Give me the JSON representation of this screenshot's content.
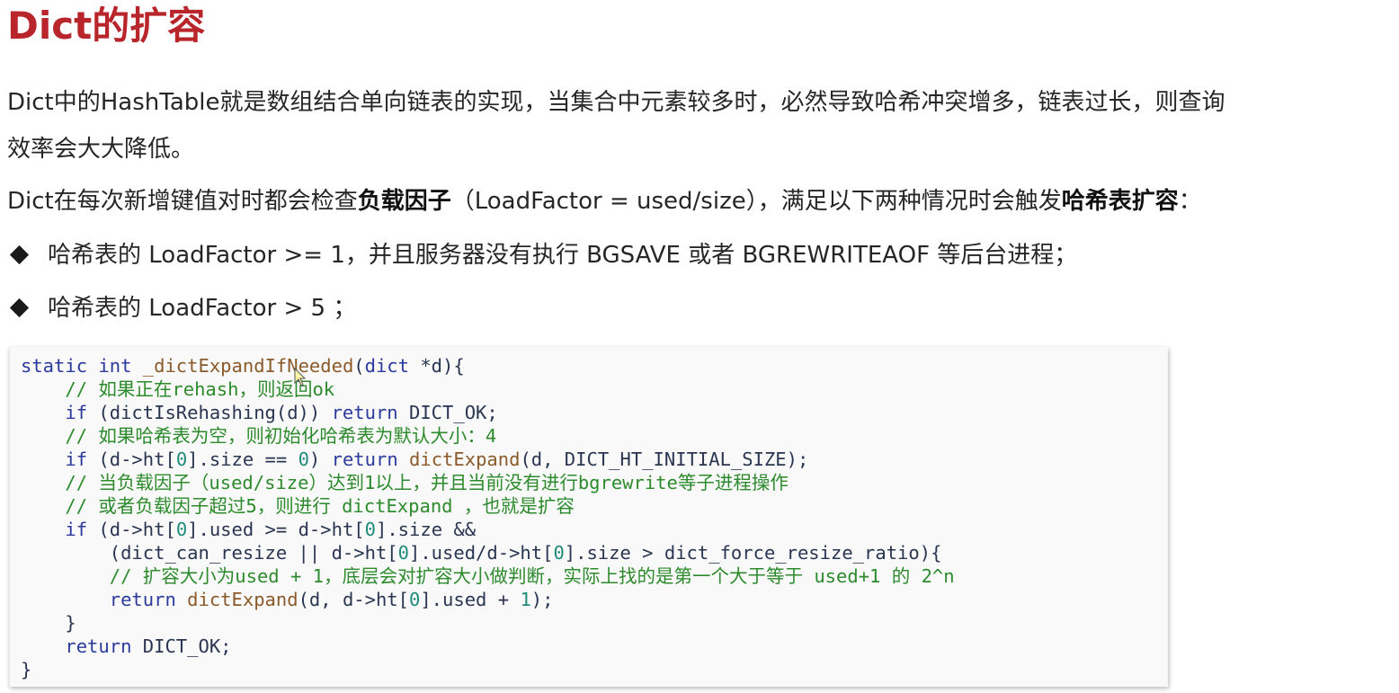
{
  "title": "Dict的扩容",
  "paragraphs": {
    "p1_line1": "Dict中的HashTable就是数组结合单向链表的实现，当集合中元素较多时，必然导致哈希冲突增多，链表过长，则查询",
    "p1_line2": "效率会大大降低。",
    "p2_pre": "Dict在每次新增键值对时都会检查",
    "p2_bold1": "负载因子",
    "p2_mid": "（LoadFactor = used/size），满足以下两种情况时会触发",
    "p2_bold2": "哈希表扩容",
    "p2_post": "："
  },
  "bullets": [
    "哈希表的 LoadFactor >= 1，并且服务器没有执行 BGSAVE 或者 BGREWRITEAOF 等后台进程；",
    "哈希表的 LoadFactor > 5 ；"
  ],
  "code": {
    "l1_kw1": "static",
    "l1_kw2": "int",
    "l1_fn": "_dictExpandIfNeeded",
    "l1_rest_a": "(",
    "l1_kw3": "dict",
    "l1_rest_b": " *d){",
    "l2": "    // 如果正在rehash，则返回ok",
    "l3_if": "if",
    "l3_a": " (dictIsRehashing(d)) ",
    "l3_ret": "return",
    "l3_b": " DICT_OK;",
    "l4": "    // 如果哈希表为空，则初始化哈希表为默认大小：4",
    "l5_if": "if",
    "l5_a": " (d->ht[",
    "l5_n0": "0",
    "l5_b": "].size == ",
    "l5_n1": "0",
    "l5_c": ") ",
    "l5_ret": "return",
    "l5_fn": " dictExpand",
    "l5_d": "(d, DICT_HT_INITIAL_SIZE);",
    "l6": "    // 当负载因子（used/size）达到1以上，并且当前没有进行bgrewrite等子进程操作",
    "l7": "    // 或者负载因子超过5，则进行 dictExpand ，也就是扩容",
    "l8_if": "if",
    "l8_a": " (d->ht[",
    "l8_n0": "0",
    "l8_b": "].used >= d->ht[",
    "l8_n1": "0",
    "l8_c": "].size &&",
    "l9_a": "        (dict_can_resize || d->ht[",
    "l9_n0": "0",
    "l9_b": "].used/d->ht[",
    "l9_n1": "0",
    "l9_c": "].size > dict_force_resize_ratio){",
    "l10": "        // 扩容大小为used + 1，底层会对扩容大小做判断，实际上找的是第一个大于等于 used+1 的 2^n",
    "l11_ret": "return",
    "l11_fn": " dictExpand",
    "l11_a": "(d, d->ht[",
    "l11_n0": "0",
    "l11_b": "].used + ",
    "l11_n1": "1",
    "l11_c": ");",
    "l12": "    }",
    "l13_ret": "return",
    "l13_a": " DICT_OK;",
    "l14": "}"
  },
  "colors": {
    "title": "#b8252a",
    "keyword": "#2b3a9c",
    "function": "#8b5a2b",
    "comment": "#2d8a2d",
    "number": "#1f8a7a",
    "code_bg": "#f8f9f8"
  },
  "icons": {
    "bullet": "diamond-bullet-icon",
    "cursor": "mouse-pointer-icon"
  }
}
